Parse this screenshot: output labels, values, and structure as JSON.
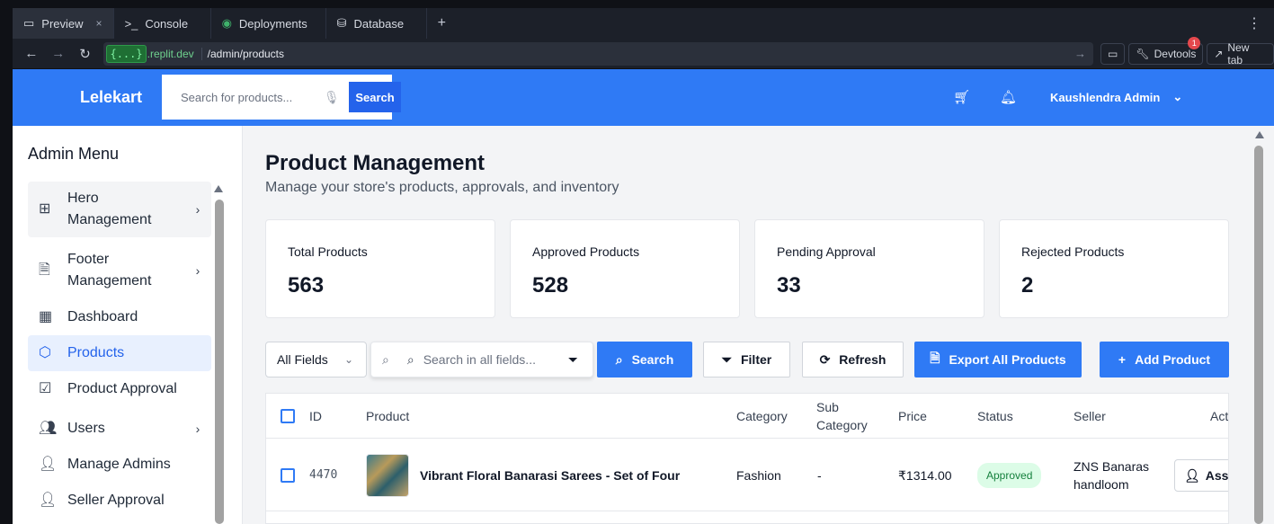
{
  "ide": {
    "tabs": [
      {
        "icon": "monitor-icon",
        "label": "Preview",
        "close": "×"
      },
      {
        "icon": "terminal-icon",
        "label": "Console"
      },
      {
        "icon": "deployments-icon",
        "label": "Deployments"
      },
      {
        "icon": "database-icon",
        "label": "Database"
      }
    ],
    "new_tab": "+",
    "menu": "⋮"
  },
  "urlbar": {
    "domain_chip": "{...}",
    "domain": ".replit.dev",
    "path": "/admin/products",
    "devtools": "Devtools",
    "devtools_badge": "1",
    "new_tab": "New tab"
  },
  "header": {
    "brand": "Lelekart",
    "search_placeholder": "Search for products...",
    "search_button": "Search",
    "user": "Kaushlendra Admin"
  },
  "sidebar": {
    "title": "Admin Menu",
    "items": [
      {
        "label": "Hero Management",
        "icon": "grid-icon"
      },
      {
        "label": "Footer Management",
        "icon": "document-icon"
      },
      {
        "label": "Dashboard",
        "icon": "dashboard-icon"
      },
      {
        "label": "Products",
        "icon": "box-icon"
      },
      {
        "label": "Product Approval",
        "icon": "check-square-icon"
      },
      {
        "label": "Users",
        "icon": "users-icon"
      },
      {
        "label": "Manage Admins",
        "icon": "user-cog-icon"
      },
      {
        "label": "Seller Approval",
        "icon": "user-check-icon"
      }
    ]
  },
  "page": {
    "title": "Product Management",
    "subtitle": "Manage your store's products, approvals, and inventory"
  },
  "stats": [
    {
      "label": "Total Products",
      "value": "563"
    },
    {
      "label": "Approved Products",
      "value": "528"
    },
    {
      "label": "Pending Approval",
      "value": "33"
    },
    {
      "label": "Rejected Products",
      "value": "2"
    }
  ],
  "controls": {
    "field_select": "All Fields",
    "search_placeholder": "Search in all fields...",
    "search": "Search",
    "filter": "Filter",
    "refresh": "Refresh",
    "export": "Export All Products",
    "add": "Add Product"
  },
  "table": {
    "columns": [
      "ID",
      "Product",
      "Category",
      "Sub Category",
      "Price",
      "Status",
      "Seller",
      "Actions"
    ],
    "rows": [
      {
        "id": "4470",
        "product": "Vibrant Floral Banarasi Sarees - Set of Four",
        "category": "Fashion",
        "sub_category": "-",
        "price": "₹1314.00",
        "status": "Approved",
        "seller": "ZNS Banaras handloom",
        "action": "Assign"
      }
    ]
  },
  "colors": {
    "primary": "#2f7af5",
    "approved_bg": "#dcfce7",
    "approved_text": "#15803d"
  }
}
